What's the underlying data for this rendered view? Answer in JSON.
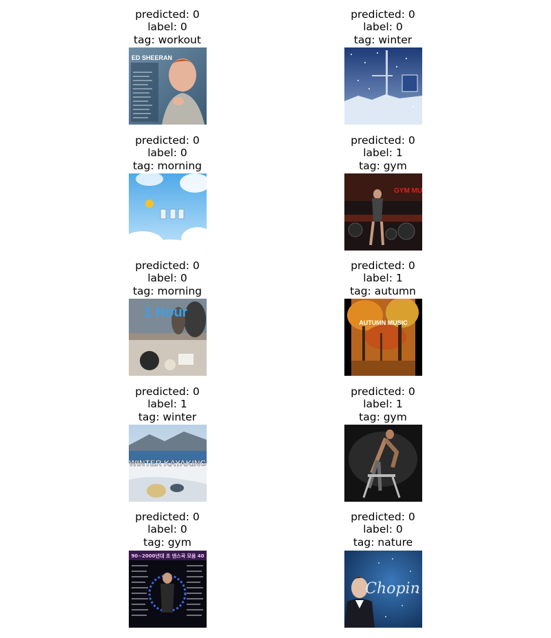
{
  "cells": [
    {
      "predicted": "predicted: 0",
      "label": "label: 0",
      "tag": "tag: workout",
      "image_text": "ED SHEERAN"
    },
    {
      "predicted": "predicted: 0",
      "label": "label: 0",
      "tag": "tag: winter",
      "image_text": ""
    },
    {
      "predicted": "predicted: 0",
      "label": "label: 0",
      "tag": "tag: morning",
      "image_text": ""
    },
    {
      "predicted": "predicted: 0",
      "label": "label: 1",
      "tag": "tag: gym",
      "image_text": "GYM MUSIC"
    },
    {
      "predicted": "predicted: 0",
      "label": "label: 0",
      "tag": "tag: morning",
      "image_text": "1 Hour"
    },
    {
      "predicted": "predicted: 0",
      "label": "label: 1",
      "tag": "tag: autumn",
      "image_text": "AUTUMN MUSIC"
    },
    {
      "predicted": "predicted: 0",
      "label": "label: 1",
      "tag": "tag: winter",
      "image_text": "WINTER KAYAKING"
    },
    {
      "predicted": "predicted: 0",
      "label": "label: 1",
      "tag": "tag: gym",
      "image_text": ""
    },
    {
      "predicted": "predicted: 0",
      "label": "label: 0",
      "tag": "tag: gym",
      "image_text": "90~2000년대 초 댄스곡 모음 40"
    },
    {
      "predicted": "predicted: 0",
      "label": "label: 0",
      "tag": "tag: nature",
      "image_text": "Chopin"
    }
  ]
}
